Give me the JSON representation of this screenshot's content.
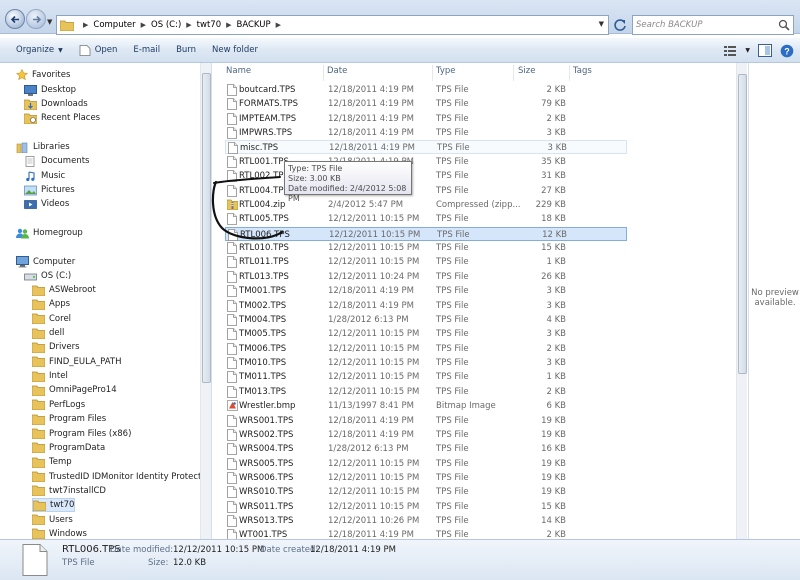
{
  "address": {
    "crumbs": [
      "Computer",
      "OS (C:)",
      "twt70",
      "BACKUP"
    ],
    "search_placeholder": "Search BACKUP"
  },
  "toolbar": {
    "organize": "Organize",
    "open": "Open",
    "email": "E-mail",
    "burn": "Burn",
    "new_folder": "New folder"
  },
  "nav": {
    "favorites": "Favorites",
    "desktop": "Desktop",
    "downloads": "Downloads",
    "recent": "Recent Places",
    "libraries": "Libraries",
    "documents": "Documents",
    "music": "Music",
    "pictures": "Pictures",
    "videos": "Videos",
    "homegroup": "Homegroup",
    "computer": "Computer",
    "osc": "OS (C:)",
    "folders": [
      "ASWebroot",
      "Apps",
      "Corel",
      "dell",
      "Drivers",
      "FIND_EULA_PATH",
      "Intel",
      "OmniPagePro14",
      "PerfLogs",
      "Program Files",
      "Program Files (x86)",
      "ProgramData",
      "Temp",
      "TrustedID IDMonitor Identity Protection",
      "twt7installCD",
      "twt70",
      "Users",
      "Windows"
    ],
    "selected_folder": "twt70"
  },
  "columns": {
    "name": "Name",
    "date": "Date",
    "type": "Type",
    "size": "Size",
    "tags": "Tags"
  },
  "files": [
    {
      "name": "boutcard.TPS",
      "date": "12/18/2011 4:19 PM",
      "type": "TPS File",
      "size": "2 KB",
      "icon": "file"
    },
    {
      "name": "FORMATS.TPS",
      "date": "12/18/2011 4:19 PM",
      "type": "TPS File",
      "size": "79 KB",
      "icon": "file"
    },
    {
      "name": "IMPTEAM.TPS",
      "date": "12/18/2011 4:19 PM",
      "type": "TPS File",
      "size": "2 KB",
      "icon": "file"
    },
    {
      "name": "IMPWRS.TPS",
      "date": "12/18/2011 4:19 PM",
      "type": "TPS File",
      "size": "3 KB",
      "icon": "file"
    },
    {
      "name": "misc.TPS",
      "date": "12/18/2011 4:19 PM",
      "type": "TPS File",
      "size": "3 KB",
      "icon": "file"
    },
    {
      "name": "RTL001.TPS",
      "date": "12/18/2011 4:19 PM",
      "type": "TPS File",
      "size": "35 KB",
      "icon": "file"
    },
    {
      "name": "RTL002.TPS",
      "date": "",
      "type": "TPS File",
      "size": "31 KB",
      "icon": "file"
    },
    {
      "name": "RTL004.TPS",
      "date": "",
      "type": "TPS File",
      "size": "27 KB",
      "icon": "file"
    },
    {
      "name": "RTL004.zip",
      "date": "2/4/2012 5:47 PM",
      "type": "Compressed (zipp...",
      "size": "229 KB",
      "icon": "zip"
    },
    {
      "name": "RTL005.TPS",
      "date": "12/12/2011 10:15 PM",
      "type": "TPS File",
      "size": "18 KB",
      "icon": "file"
    },
    {
      "name": "RTL006.TPS",
      "date": "12/12/2011 10:15 PM",
      "type": "TPS File",
      "size": "12 KB",
      "icon": "file"
    },
    {
      "name": "RTL010.TPS",
      "date": "12/12/2011 10:15 PM",
      "type": "TPS File",
      "size": "15 KB",
      "icon": "file"
    },
    {
      "name": "RTL011.TPS",
      "date": "12/12/2011 10:15 PM",
      "type": "TPS File",
      "size": "1 KB",
      "icon": "file"
    },
    {
      "name": "RTL013.TPS",
      "date": "12/12/2011 10:24 PM",
      "type": "TPS File",
      "size": "26 KB",
      "icon": "file"
    },
    {
      "name": "TM001.TPS",
      "date": "12/18/2011 4:19 PM",
      "type": "TPS File",
      "size": "3 KB",
      "icon": "file"
    },
    {
      "name": "TM002.TPS",
      "date": "12/18/2011 4:19 PM",
      "type": "TPS File",
      "size": "3 KB",
      "icon": "file"
    },
    {
      "name": "TM004.TPS",
      "date": "1/28/2012 6:13 PM",
      "type": "TPS File",
      "size": "4 KB",
      "icon": "file"
    },
    {
      "name": "TM005.TPS",
      "date": "12/12/2011 10:15 PM",
      "type": "TPS File",
      "size": "3 KB",
      "icon": "file"
    },
    {
      "name": "TM006.TPS",
      "date": "12/12/2011 10:15 PM",
      "type": "TPS File",
      "size": "2 KB",
      "icon": "file"
    },
    {
      "name": "TM010.TPS",
      "date": "12/12/2011 10:15 PM",
      "type": "TPS File",
      "size": "3 KB",
      "icon": "file"
    },
    {
      "name": "TM011.TPS",
      "date": "12/12/2011 10:15 PM",
      "type": "TPS File",
      "size": "1 KB",
      "icon": "file"
    },
    {
      "name": "TM013.TPS",
      "date": "12/12/2011 10:15 PM",
      "type": "TPS File",
      "size": "2 KB",
      "icon": "file"
    },
    {
      "name": "Wrestler.bmp",
      "date": "11/13/1997 8:41 PM",
      "type": "Bitmap Image",
      "size": "6 KB",
      "icon": "bmp"
    },
    {
      "name": "WRS001.TPS",
      "date": "12/18/2011 4:19 PM",
      "type": "TPS File",
      "size": "19 KB",
      "icon": "file"
    },
    {
      "name": "WRS002.TPS",
      "date": "12/18/2011 4:19 PM",
      "type": "TPS File",
      "size": "19 KB",
      "icon": "file"
    },
    {
      "name": "WRS004.TPS",
      "date": "1/28/2012 6:13 PM",
      "type": "TPS File",
      "size": "16 KB",
      "icon": "file"
    },
    {
      "name": "WRS005.TPS",
      "date": "12/12/2011 10:15 PM",
      "type": "TPS File",
      "size": "19 KB",
      "icon": "file"
    },
    {
      "name": "WRS006.TPS",
      "date": "12/12/2011 10:15 PM",
      "type": "TPS File",
      "size": "19 KB",
      "icon": "file"
    },
    {
      "name": "WRS010.TPS",
      "date": "12/12/2011 10:15 PM",
      "type": "TPS File",
      "size": "19 KB",
      "icon": "file"
    },
    {
      "name": "WRS011.TPS",
      "date": "12/12/2011 10:15 PM",
      "type": "TPS File",
      "size": "15 KB",
      "icon": "file"
    },
    {
      "name": "WRS013.TPS",
      "date": "12/12/2011 10:26 PM",
      "type": "TPS File",
      "size": "14 KB",
      "icon": "file"
    },
    {
      "name": "WT001.TPS",
      "date": "12/18/2011 4:19 PM",
      "type": "TPS File",
      "size": "2 KB",
      "icon": "file"
    }
  ],
  "selected_file": "RTL006.TPS",
  "hovered_file": "misc.TPS",
  "tooltip": {
    "type": "Type: TPS File",
    "size": "Size: 3.00 KB",
    "modified": "Date modified: 2/4/2012 5:08 PM"
  },
  "preview": {
    "line1": "No preview",
    "line2": "available."
  },
  "details": {
    "filename": "RTL006.TPS",
    "modified_label": "Date modified:",
    "modified_value": "12/12/2011 10:15 PM",
    "created_label": "Date created:",
    "created_value": "12/18/2011 4:19 PM",
    "type": "TPS File",
    "size_label": "Size:",
    "size_value": "12.0 KB"
  },
  "colors": {
    "selection": "#d5e5fa",
    "selection_border": "#84acdd",
    "folder": "#e8c25a"
  }
}
